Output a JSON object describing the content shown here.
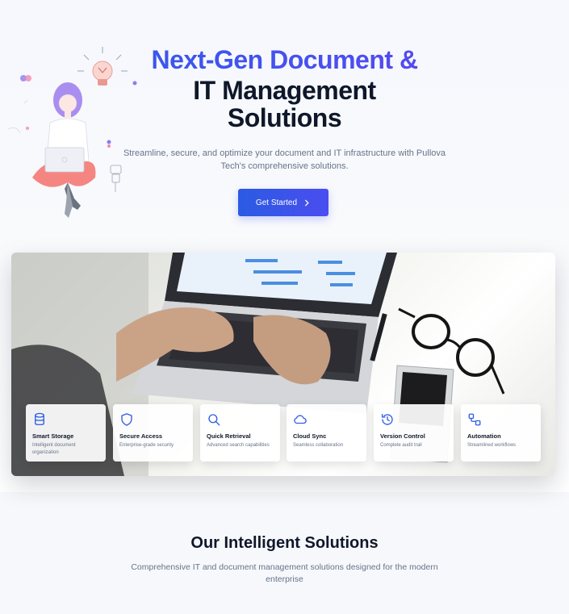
{
  "hero": {
    "title_line1": "Next-Gen Document &",
    "title_line2": "IT Management",
    "title_line3": "Solutions",
    "subtitle": "Streamline, secure, and optimize your document and IT infrastructure with Pullova Tech's comprehensive solutions.",
    "cta_label": "Get Started",
    "cta_icon": "chevron-right-icon"
  },
  "features": [
    {
      "title": "Smart Storage",
      "description": "Intelligent document organization",
      "icon": "database-icon"
    },
    {
      "title": "Secure Access",
      "description": "Enterprise-grade security",
      "icon": "shield-icon"
    },
    {
      "title": "Quick Retrieval",
      "description": "Advanced search capabilities",
      "icon": "search-icon"
    },
    {
      "title": "Cloud Sync",
      "description": "Seamless collaboration",
      "icon": "cloud-icon"
    },
    {
      "title": "Version Control",
      "description": "Complete audit trail",
      "icon": "history-icon"
    },
    {
      "title": "Automation",
      "description": "Streamlined workflows",
      "icon": "workflow-icon"
    }
  ],
  "solutions": {
    "title": "Our Intelligent Solutions",
    "subtitle": "Comprehensive IT and document management solutions designed for the modern enterprise"
  },
  "colors": {
    "accent": "#3b5bec",
    "icon": "#2f5ce8",
    "heading": "#0f172a",
    "muted": "#64748b"
  }
}
